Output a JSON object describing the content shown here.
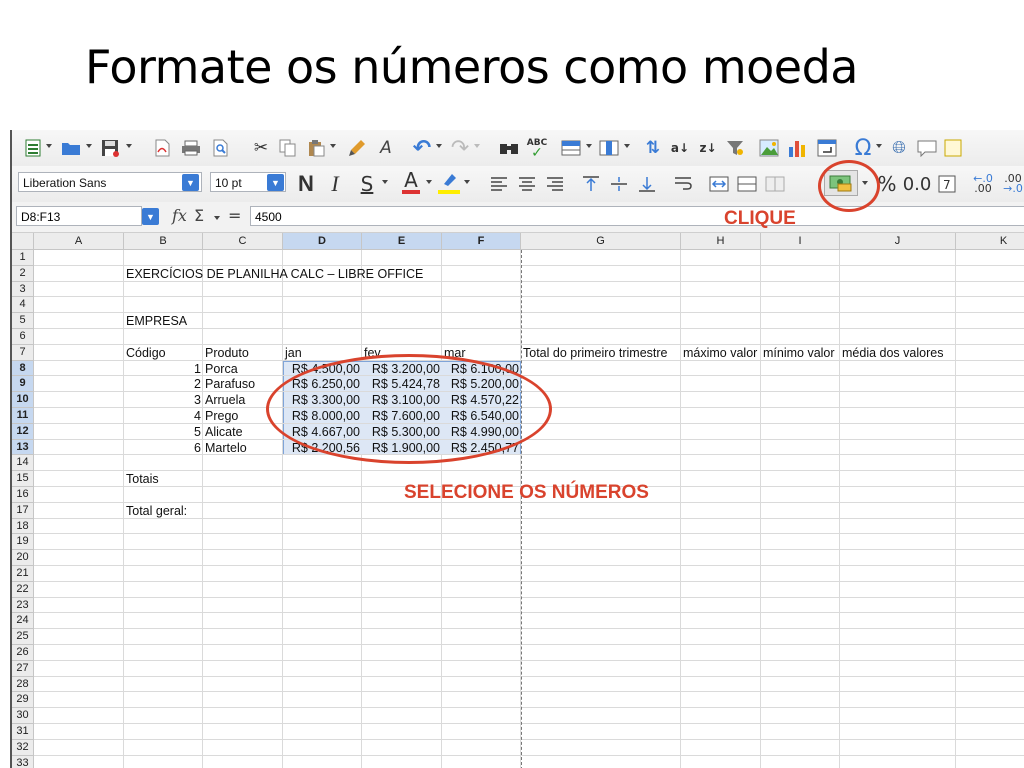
{
  "slide": {
    "title": "Formate os números como moeda",
    "annotation_click": "CLIQUE",
    "annotation_select": "SELECIONE OS NÚMEROS",
    "annotation_color": "#d9432d"
  },
  "toolbar": {
    "font_name": "Liberation Sans",
    "font_size": "10 pt",
    "bold_label": "N",
    "italic_label": "I",
    "underline_label": "S",
    "font_color_label": "A",
    "percent_label": "%",
    "decimal_label": "0.0",
    "icons_row1": [
      "new-icon",
      "open-icon",
      "save-icon",
      "export-pdf-icon",
      "print-icon",
      "print-preview-icon",
      "cut-icon",
      "copy-icon",
      "paste-icon",
      "clone-formatting-icon",
      "clear-formatting-icon",
      "undo-icon",
      "redo-icon",
      "find-replace-icon",
      "spelling-icon",
      "row-icon",
      "column-icon",
      "sort-icon",
      "sort-ascending-icon",
      "sort-descending-icon",
      "autofilter-icon",
      "image-icon",
      "chart-icon",
      "pivot-table-icon",
      "special-character-icon",
      "hyperlink-icon",
      "comment-icon",
      "headers-footers-icon"
    ],
    "icons_row2": [
      "align-left-icon",
      "align-center-icon",
      "align-right-icon",
      "align-top-icon",
      "align-center-vertical-icon",
      "align-bottom-icon",
      "wrap-text-icon",
      "merge-center-icon",
      "merge-cells-icon",
      "unmerge-cells-icon",
      "currency-format-icon",
      "percent-format-icon",
      "number-format-icon",
      "date-format-icon",
      "add-decimal-icon",
      "delete-decimal-icon"
    ]
  },
  "formula_bar": {
    "name_box": "D8:F13",
    "fx": "fx",
    "sum": "Σ",
    "equals": "=",
    "value": "4500"
  },
  "columns": [
    "A",
    "B",
    "C",
    "D",
    "E",
    "F",
    "G",
    "H",
    "I",
    "J",
    "K"
  ],
  "selected_columns": [
    "D",
    "E",
    "F"
  ],
  "rows": [
    "1",
    "2",
    "3",
    "4",
    "5",
    "6",
    "7",
    "8",
    "9",
    "10",
    "11",
    "12",
    "13",
    "14",
    "15",
    "16",
    "17",
    "18",
    "19",
    "20",
    "21",
    "22",
    "23",
    "24",
    "25",
    "26",
    "27",
    "28",
    "29",
    "30",
    "31",
    "32",
    "33"
  ],
  "selected_rows": [
    "8",
    "9",
    "10",
    "11",
    "12",
    "13"
  ],
  "sheet": {
    "title": "EXERCÍCIOS DE PLANILHA CALC – LIBRE OFFICE",
    "empresa": "EMPRESA",
    "headers": {
      "codigo": "Código",
      "produto": "Produto",
      "jan": "jan",
      "fev": "fev",
      "mar": "mar",
      "total_trimestre": "Total do primeiro trimestre",
      "maximo": "máximo valor",
      "minimo": "mínimo valor",
      "media": "média dos valores"
    },
    "data": [
      {
        "codigo": "1",
        "produto": "Porca",
        "jan": "R$ 4.500,00",
        "fev": "R$ 3.200,00",
        "mar": "R$ 6.100,00"
      },
      {
        "codigo": "2",
        "produto": "Parafuso",
        "jan": "R$ 6.250,00",
        "fev": "R$ 5.424,78",
        "mar": "R$ 5.200,00"
      },
      {
        "codigo": "3",
        "produto": "Arruela",
        "jan": "R$ 3.300,00",
        "fev": "R$ 3.100,00",
        "mar": "R$ 4.570,22"
      },
      {
        "codigo": "4",
        "produto": "Prego",
        "jan": "R$ 8.000,00",
        "fev": "R$ 7.600,00",
        "mar": "R$ 6.540,00"
      },
      {
        "codigo": "5",
        "produto": "Alicate",
        "jan": "R$ 4.667,00",
        "fev": "R$ 5.300,00",
        "mar": "R$ 4.990,00"
      },
      {
        "codigo": "6",
        "produto": "Martelo",
        "jan": "R$ 2.200,56",
        "fev": "R$ 1.900,00",
        "mar": "R$ 2.450,77"
      }
    ],
    "totais": "Totais",
    "total_geral": "Total geral:"
  }
}
